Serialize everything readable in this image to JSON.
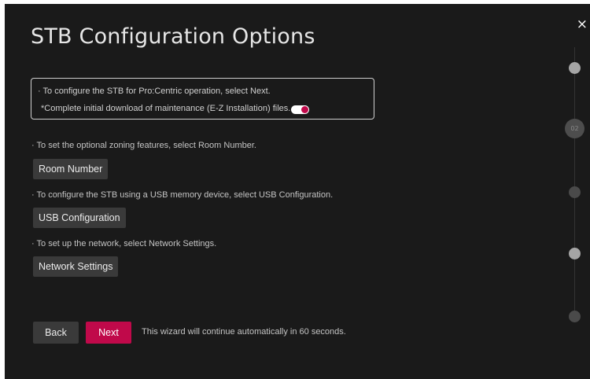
{
  "title": "STB Configuration Options",
  "close_glyph": "×",
  "info_box": {
    "line1": "· To configure the STB for Pro:Centric operation, select Next.",
    "line2": "*Complete initial download of maintenance (E-Z Installation) files.",
    "toggle_on": true
  },
  "options": [
    {
      "hint": "· To set the optional zoning features, select Room Number.",
      "button": "Room Number"
    },
    {
      "hint": "· To configure the STB using a USB memory device, select USB Configuration.",
      "button": "USB Configuration"
    },
    {
      "hint": "· To set up the network, select Network Settings.",
      "button": "Network Settings"
    }
  ],
  "footer": {
    "back_label": "Back",
    "next_label": "Next",
    "auto_text": "This wizard will continue automatically in 60 seconds."
  },
  "stepper": {
    "current_step": "02"
  },
  "colors": {
    "background": "#1a1a1a",
    "accent": "#c0094a",
    "button": "#3a3a3a"
  }
}
